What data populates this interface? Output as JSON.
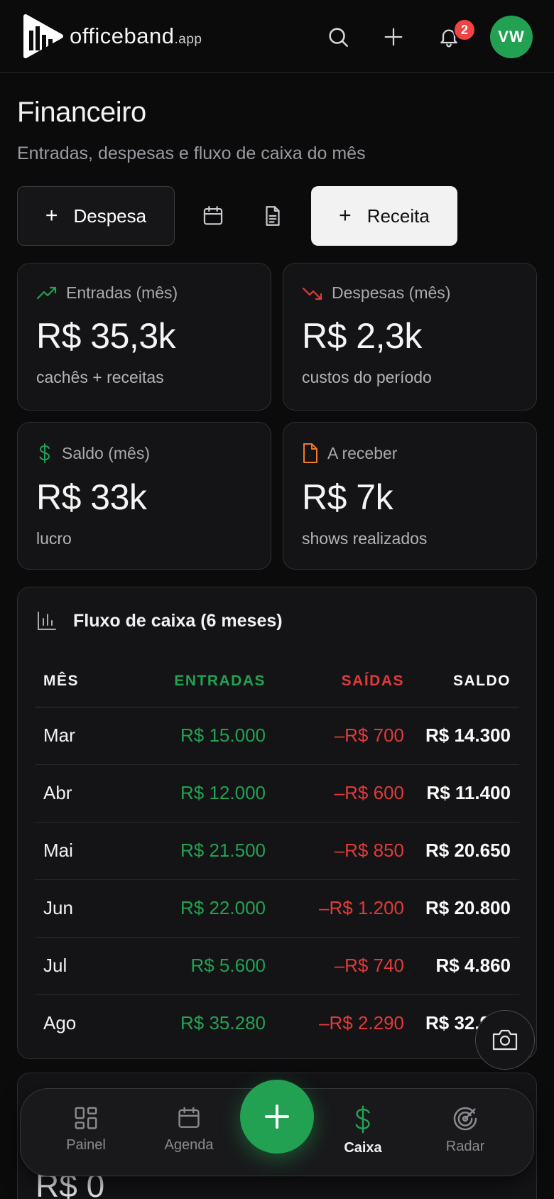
{
  "header": {
    "brand_name": "officeband",
    "brand_suffix": ".app",
    "notification_count": "2",
    "avatar_initials": "VW"
  },
  "page": {
    "title": "Financeiro",
    "subtitle": "Entradas, despesas e fluxo de caixa do mês"
  },
  "actions": {
    "expense_label": "Despesa",
    "income_label": "Receita"
  },
  "stats": [
    {
      "label": "Entradas (mês)",
      "value": "R$ 35,3k",
      "sub": "cachês + receitas",
      "icon": "trending-up-icon",
      "color": "#22a152"
    },
    {
      "label": "Despesas (mês)",
      "value": "R$ 2,3k",
      "sub": "custos do período",
      "icon": "trending-down-icon",
      "color": "#e03a3a"
    },
    {
      "label": "Saldo (mês)",
      "value": "R$ 33k",
      "sub": "lucro",
      "icon": "dollar-icon",
      "color": "#22a152"
    },
    {
      "label": "A receber",
      "value": "R$ 7k",
      "sub": "shows realizados",
      "icon": "document-icon",
      "color": "#f07a2a"
    }
  ],
  "cashflow": {
    "title": "Fluxo de caixa (6 meses)",
    "columns": [
      "MÊS",
      "ENTRADAS",
      "SAÍDAS",
      "SALDO"
    ],
    "rows": [
      {
        "month": "Mar",
        "in": "R$ 15.000",
        "out": "–R$ 700",
        "balance": "R$ 14.300"
      },
      {
        "month": "Abr",
        "in": "R$ 12.000",
        "out": "–R$ 600",
        "balance": "R$ 11.400"
      },
      {
        "month": "Mai",
        "in": "R$ 21.500",
        "out": "–R$ 850",
        "balance": "R$ 20.650"
      },
      {
        "month": "Jun",
        "in": "R$ 22.000",
        "out": "–R$ 1.200",
        "balance": "R$ 20.800"
      },
      {
        "month": "Jul",
        "in": "R$ 5.600",
        "out": "–R$ 740",
        "balance": "R$ 4.860"
      },
      {
        "month": "Ago",
        "in": "R$ 35.280",
        "out": "–R$ 2.290",
        "balance": "R$ 32.990"
      }
    ]
  },
  "next_card": {
    "value": "R$ 0"
  },
  "nav": {
    "items": [
      {
        "label": "Painel",
        "icon": "dashboard-icon"
      },
      {
        "label": "Agenda",
        "icon": "calendar-icon"
      },
      {
        "label": "Caixa",
        "icon": "dollar-icon"
      },
      {
        "label": "Radar",
        "icon": "radar-icon"
      }
    ],
    "active": "Caixa"
  },
  "colors": {
    "accent_green": "#22a152",
    "negative_red": "#e03a3a",
    "warning_orange": "#f07a2a",
    "background": "#0b0b0c"
  }
}
